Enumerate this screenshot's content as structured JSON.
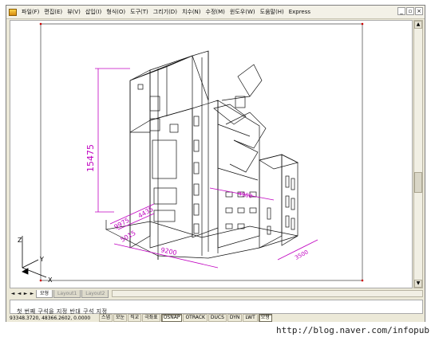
{
  "menu": {
    "items": [
      "파일(F)",
      "편집(E)",
      "뷰(V)",
      "삽입(I)",
      "형식(O)",
      "도구(T)",
      "그리기(D)",
      "치수(N)",
      "수정(M)",
      "윈도우(W)",
      "도움말(H)",
      "Express"
    ]
  },
  "window_controls": {
    "minimize": "_",
    "restore": "▫",
    "close": "×"
  },
  "drawing": {
    "dimensions": [
      "15475",
      "9975",
      "5015",
      "4435",
      "9200",
      "3500",
      "4980"
    ],
    "ucs_labels": {
      "z": "Z",
      "y": "Y",
      "x": "X"
    }
  },
  "tabs": {
    "nav": [
      "◄",
      "◄",
      "►",
      "►"
    ],
    "items": [
      "모형",
      "Layout1",
      "Layout2"
    ],
    "active": "모형"
  },
  "command": {
    "line": "첫 번째 구석을 지정 반대 구석 지정"
  },
  "status": {
    "coords": "93348.3720, 48366.2602, 0.0000",
    "buttons": [
      "스냅",
      "모눈",
      "직교",
      "극좌표",
      "OSNAP",
      "OTRACK",
      "DUCS",
      "DYN",
      "LWT",
      "모형"
    ],
    "active_buttons": [
      "OSNAP",
      "모형"
    ]
  },
  "watermark": "http://blog.naver.com/infopub",
  "colors": {
    "dimension": "#c000c0",
    "geometry": "#000000",
    "accent": "#d4d0c8"
  }
}
